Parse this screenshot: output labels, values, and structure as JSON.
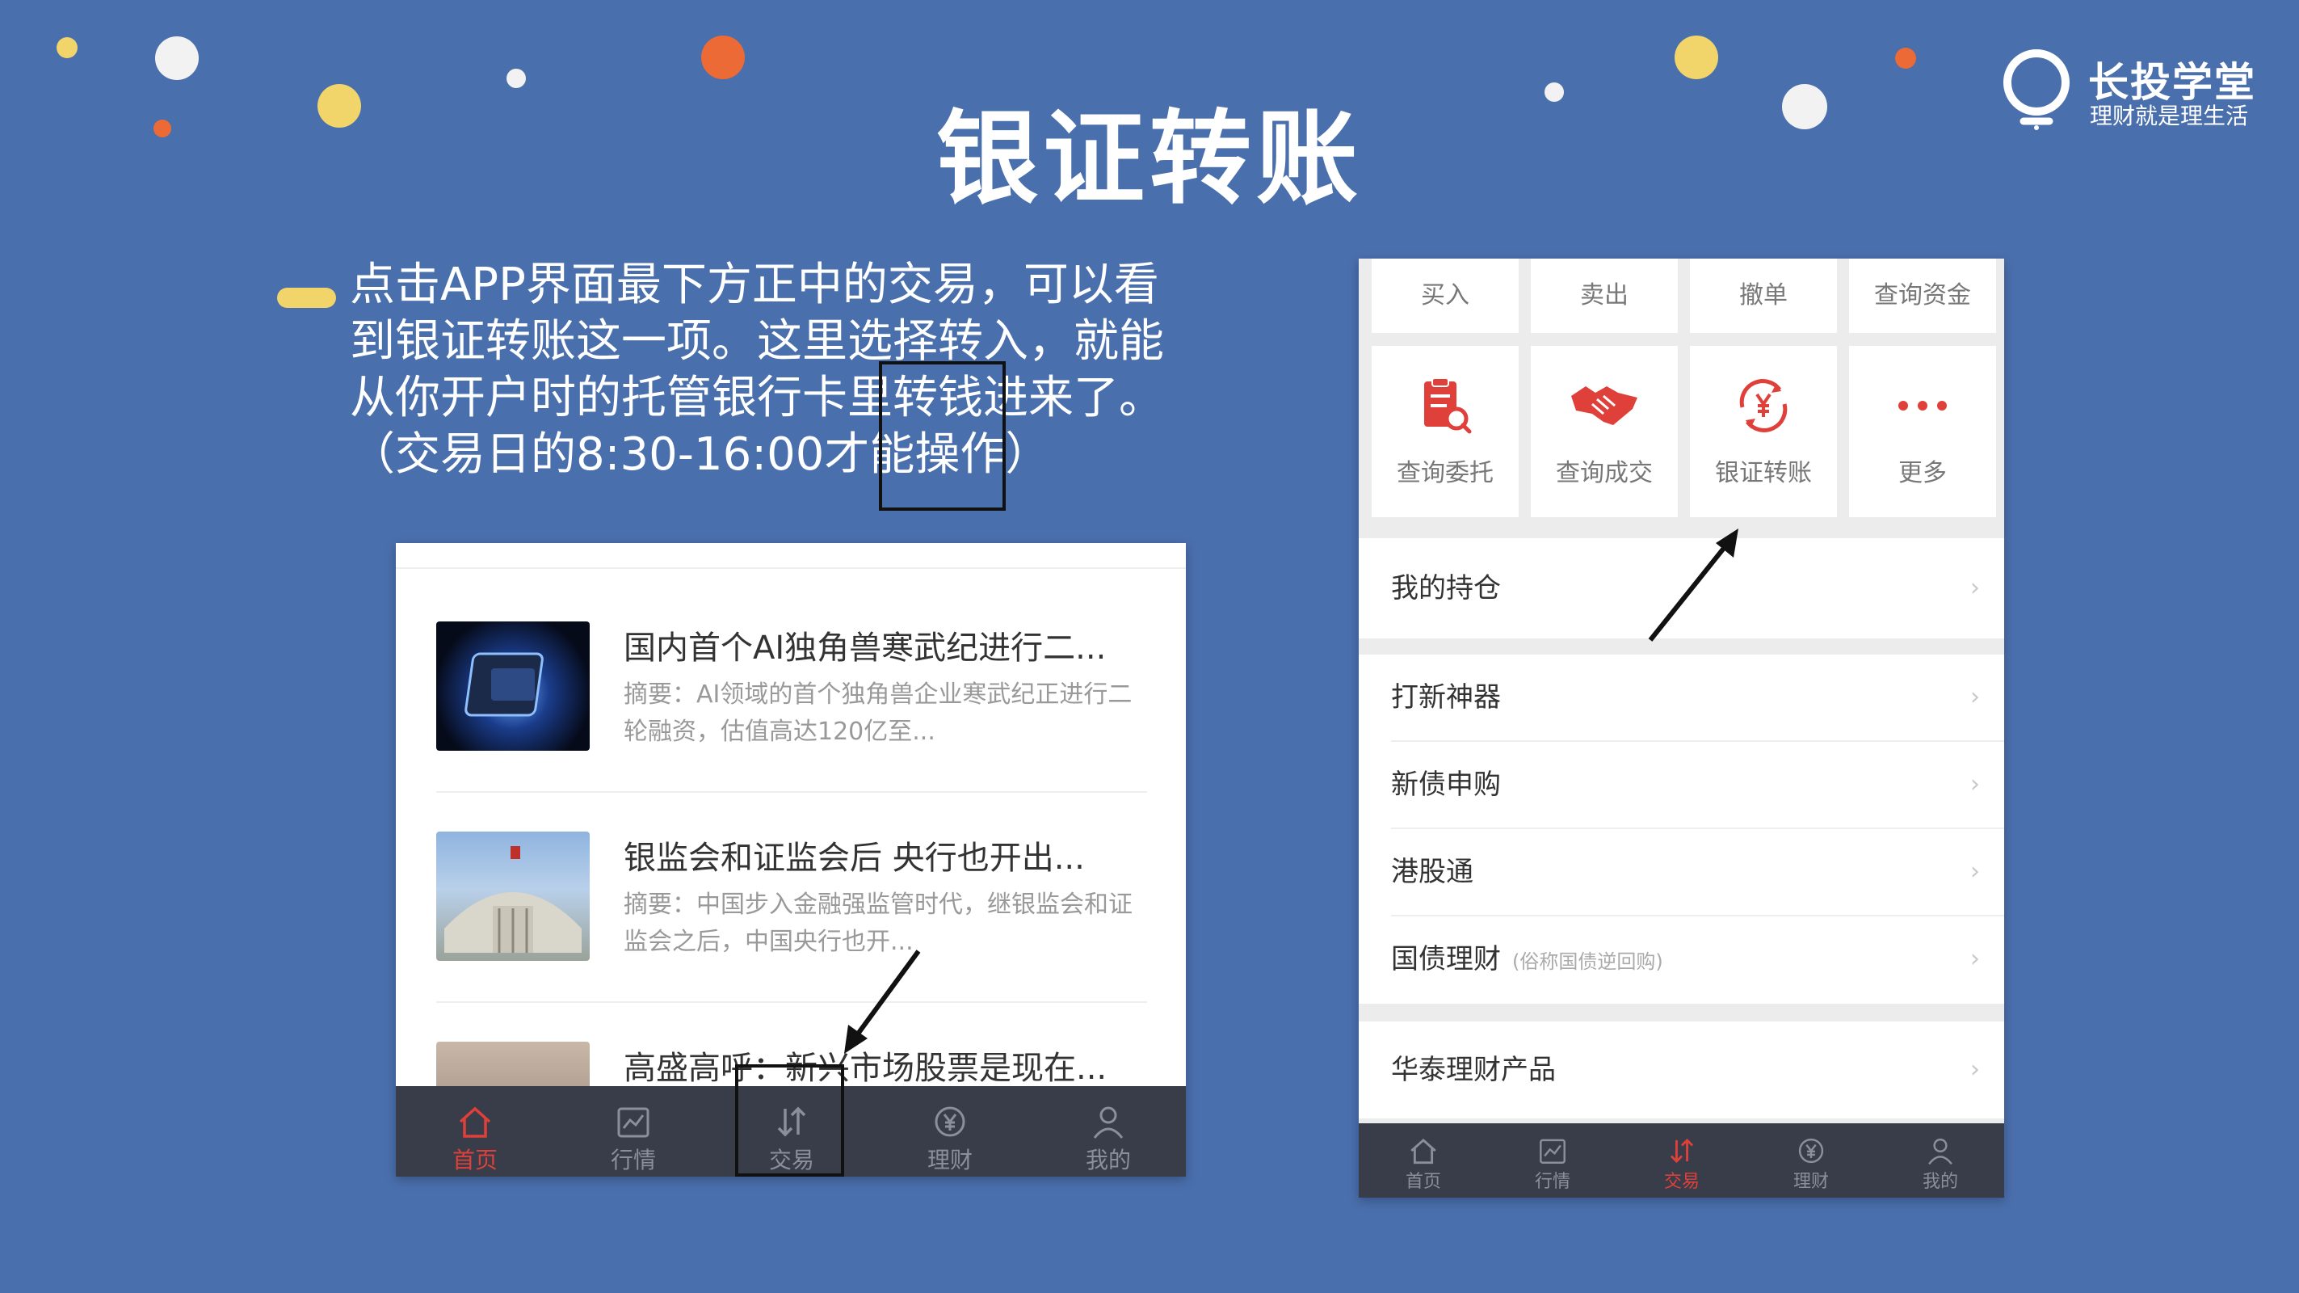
{
  "slide": {
    "title": "银证转账",
    "brand_name": "长投学堂",
    "brand_slogan": "理财就是理生活",
    "description_lines": [
      "点击APP界面最下方正中的交易，可以看",
      "到银证转账这一项。这里选择转入，就能",
      "从你开户时的托管银行卡里转钱进来了。",
      "（交易日的8:30-16:00才能操作）"
    ]
  },
  "phone_home": {
    "news": [
      {
        "title": "国内首个AI独角兽寒武纪进行二...",
        "summary": "摘要：AI领域的首个独角兽企业寒武纪正进行二轮融资，估值高达120亿至..."
      },
      {
        "title": "银监会和证监会后 央行也开出...",
        "summary": "摘要：中国步入金融强监管时代，继银监会和证监会之后，中国央行也开..."
      },
      {
        "title": "高盛高呼：新兴市场股票是现在...",
        "summary": ""
      }
    ],
    "tabs": [
      "首页",
      "行情",
      "交易",
      "理财",
      "我的"
    ],
    "active_tab": "首页"
  },
  "phone_trade": {
    "quick_buttons": [
      "买入",
      "卖出",
      "撤单",
      "查询资金"
    ],
    "icon_buttons": [
      {
        "label": "查询委托",
        "icon": "clipboard-search-icon"
      },
      {
        "label": "查询成交",
        "icon": "handshake-icon"
      },
      {
        "label": "银证转账",
        "icon": "yen-transfer-icon"
      },
      {
        "label": "更多",
        "icon": "more-dots-icon"
      }
    ],
    "menu": {
      "holdings": "我的持仓",
      "ipo_tool": "打新神器",
      "bond_subscribe": "新债申购",
      "hk_connect": "港股通",
      "treasury": "国债理财",
      "treasury_note": "(俗称国债逆回购)",
      "huatai_products": "华泰理财产品"
    },
    "tabs": [
      "首页",
      "行情",
      "交易",
      "理财",
      "我的"
    ],
    "active_tab": "交易"
  },
  "colors": {
    "background": "#4a6fad",
    "accent_red": "#e0403a",
    "highlight_yellow": "#f1d46a",
    "tabbar": "#383d49"
  }
}
